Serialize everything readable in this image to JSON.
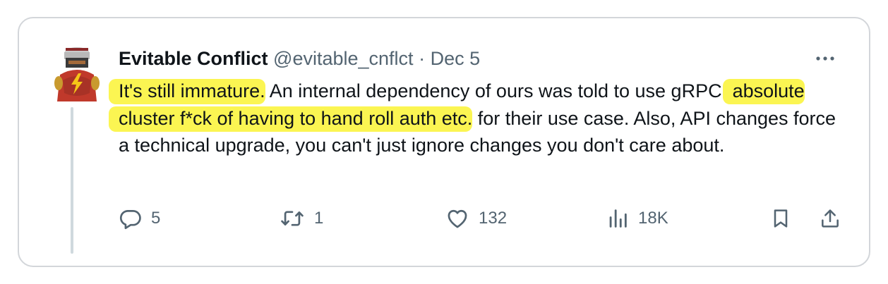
{
  "tweet": {
    "author_name": "Evitable Conflict",
    "handle": "@evitable_cnflct",
    "separator": "·",
    "date": "Dec 5",
    "more_icon": "more-dots-icon",
    "body": {
      "hl1": "It's still immature.",
      "t1": " An internal dependency of ours was told to use gRPC, ",
      "hl2": "absolute cluster f*ck of having to hand roll auth etc.",
      "t2": " for their use case. Also, API changes force a technical upgrade, you can't just ignore changes you don't care about."
    },
    "highlight_color": "#fbf552"
  },
  "actions": {
    "replies": "5",
    "retweets": "1",
    "likes": "132",
    "views": "18K"
  }
}
